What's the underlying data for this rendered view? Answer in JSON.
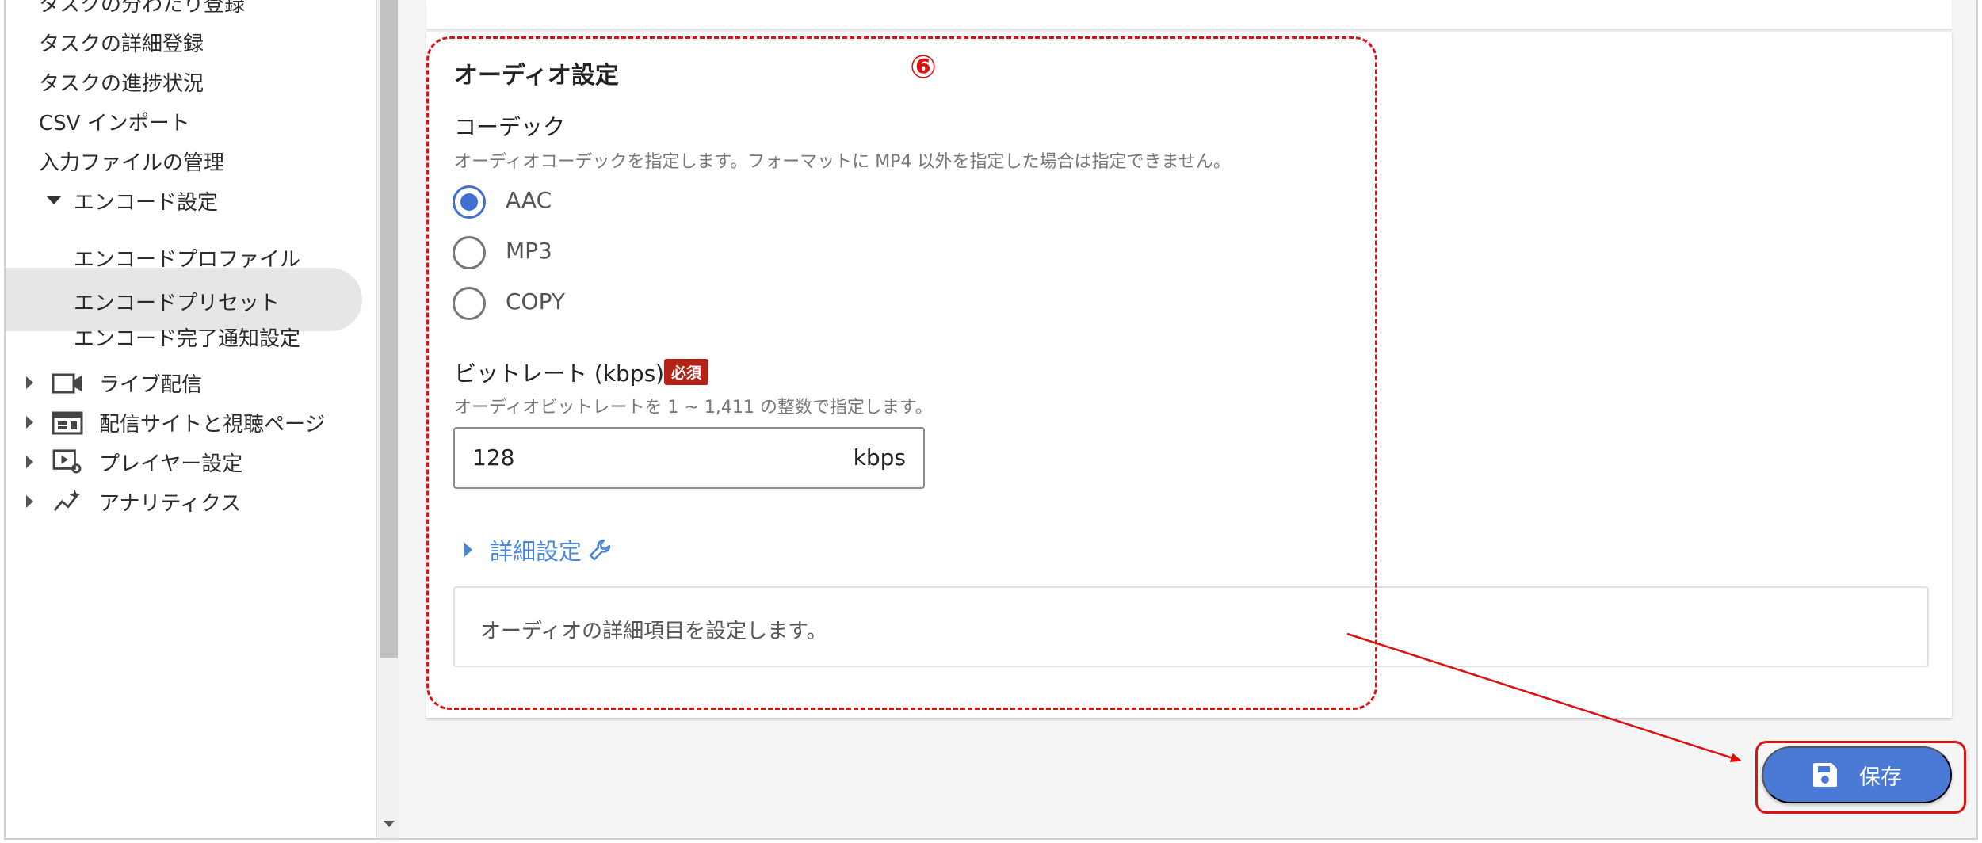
{
  "sidebar": {
    "items": [
      {
        "label": "タスクの分わたり登録"
      },
      {
        "label": "タスクの詳細登録"
      },
      {
        "label": "タスクの進捗状況"
      },
      {
        "label": "CSV インポート"
      },
      {
        "label": "入力ファイルの管理"
      },
      {
        "label": "エンコード設定"
      },
      {
        "label": "エンコードプロファイル"
      },
      {
        "label": "エンコードプリセット"
      },
      {
        "label": "エンコード完了通知設定"
      },
      {
        "label": "ライブ配信"
      },
      {
        "label": "配信サイトと視聴ページ"
      },
      {
        "label": "プレイヤー設定"
      },
      {
        "label": "アナリティクス"
      }
    ],
    "active_item": "エンコードプリセット"
  },
  "audio": {
    "step_marker": "⑥",
    "title": "オーディオ設定",
    "codec": {
      "label": "コーデック",
      "help": "オーディオコーデックを指定します。フォーマットに MP4 以外を指定した場合は指定できません。",
      "options": [
        "AAC",
        "MP3",
        "COPY"
      ],
      "selected": "AAC"
    },
    "bitrate": {
      "label": "ビットレート (kbps)",
      "required_badge": "必須",
      "help": "オーディオビットレートを 1 ~ 1,411 の整数で指定します。",
      "value": "128",
      "unit": "kbps"
    },
    "advanced": {
      "label": "詳細設定",
      "description": "オーディオの詳細項目を設定します。"
    }
  },
  "actions": {
    "save_label": "保存"
  },
  "colors": {
    "accent": "#4a7ad6",
    "link": "#4a86d8",
    "annotation": "#e01010",
    "required": "#b42318"
  }
}
